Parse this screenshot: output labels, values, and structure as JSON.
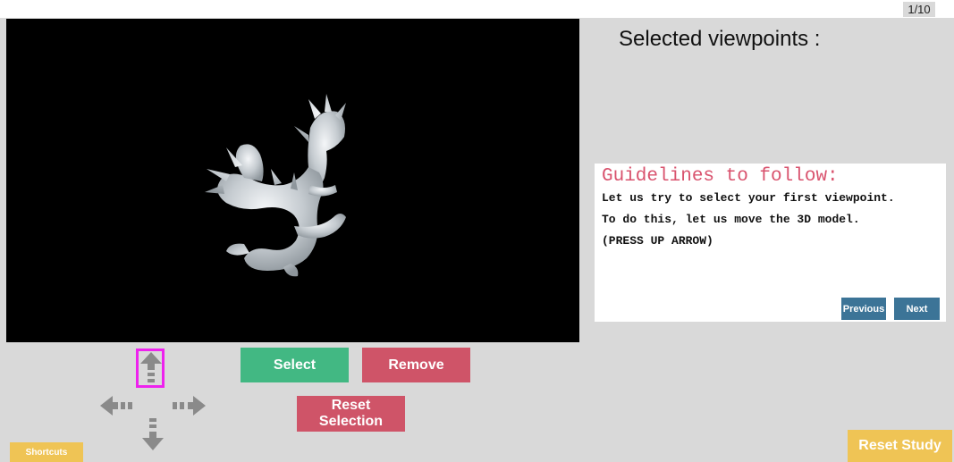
{
  "header": {
    "page_counter": "1/10"
  },
  "viewer": {
    "model_icon": "dragon-3d-model"
  },
  "selected_viewpoints": {
    "title": "Selected viewpoints :"
  },
  "guidelines": {
    "title": "Guidelines to follow:",
    "lines": [
      "Let us try to select your first viewpoint.",
      "To do this, let us move the 3D model.",
      "(PRESS UP ARROW)"
    ],
    "previous_label": "Previous",
    "next_label": "Next"
  },
  "controls": {
    "select_label": "Select",
    "remove_label": "Remove",
    "reset_selection_line1": "Reset",
    "reset_selection_line2": "Selection",
    "highlighted_arrow": "up"
  },
  "footer": {
    "shortcuts_label": "Shortcuts",
    "reset_study_label": "Reset Study"
  },
  "colors": {
    "select": "#42b883",
    "remove": "#cf5468",
    "reset_selection": "#cf5468",
    "nav_button": "#3c7497",
    "guideline_title": "#d9536e",
    "highlight": "#ee22ee",
    "yellow_button": "#efc455",
    "arrow": "#8a8a8a"
  }
}
